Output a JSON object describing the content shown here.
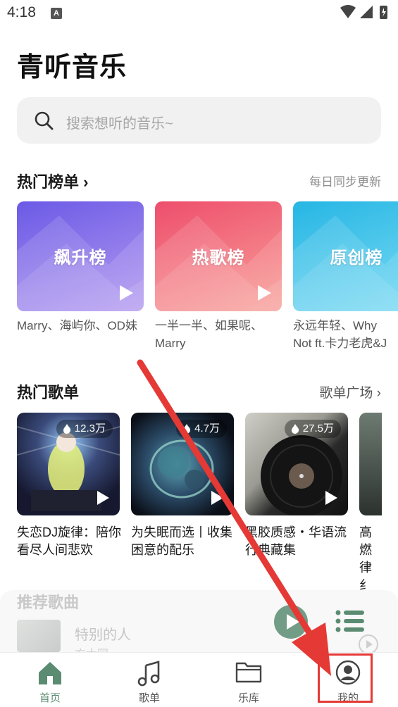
{
  "status": {
    "time": "4:18",
    "notification_letter": "A"
  },
  "app": {
    "title": "青听音乐"
  },
  "search": {
    "placeholder": "搜索想听的音乐~"
  },
  "charts_section": {
    "title": "热门榜单",
    "right_text": "每日同步更新"
  },
  "charts": [
    {
      "title": "飙升榜",
      "desc": "Marry、海屿你、OD妹",
      "gradient_from": "#6b5ae6",
      "gradient_to": "#b49af0"
    },
    {
      "title": "热歌榜",
      "desc": "一半一半、如果呢、Marry",
      "gradient_from": "#ee4e6c",
      "gradient_to": "#f8a19a"
    },
    {
      "title": "原创榜",
      "desc": "永远年轻、Why Not ft.卡力老虎&J",
      "gradient_from": "#26b6e4",
      "gradient_to": "#77d9f3"
    }
  ],
  "playlists_section": {
    "title": "热门歌单",
    "right_text": "歌单广场"
  },
  "playlists": [
    {
      "name": "失恋DJ旋律：陪你看尽人间悲欢",
      "plays": "12.3万"
    },
    {
      "name": "为失眠而选丨收集困意的配乐",
      "plays": "4.7万"
    },
    {
      "name": "黑胶质感・华语流行典藏集",
      "plays": "27.5万"
    },
    {
      "name": "高燃律纟"
    }
  ],
  "recommend": {
    "title": "推荐歌曲",
    "song": "特别的人",
    "artist": "方大同"
  },
  "nav": [
    {
      "label": "首页",
      "icon": "home-icon",
      "active": true
    },
    {
      "label": "歌单",
      "icon": "music-note-icon",
      "active": false
    },
    {
      "label": "乐库",
      "icon": "folder-icon",
      "active": false
    },
    {
      "label": "我的",
      "icon": "profile-icon",
      "active": false
    }
  ],
  "colors": {
    "accent": "#5b8c72",
    "annotation": "#e53935"
  }
}
